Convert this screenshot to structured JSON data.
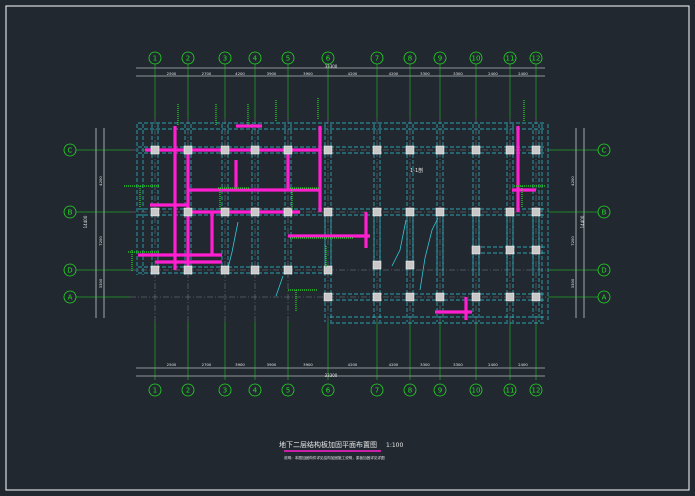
{
  "drawing": {
    "title": "地下二层结构板加固平面布置图",
    "scale": "1:100",
    "note": "说明：本图加固构件详见结构加固施工说明，梁板加固详见详图",
    "center_label": "1-1剖",
    "total_dim_top": "33300",
    "total_dim_bottom": "33300",
    "total_dim_left": "14400",
    "total_dim_right": "14400"
  },
  "axes": {
    "vertical_top": [
      "1",
      "2",
      "3",
      "4",
      "5",
      "6",
      "7",
      "8",
      "9",
      "10",
      "11",
      "12"
    ],
    "vertical_bottom": [
      "1",
      "2",
      "3",
      "4",
      "5",
      "6",
      "7",
      "8",
      "9",
      "10",
      "11",
      "12"
    ],
    "horizontal_left": [
      "C",
      "B",
      "D",
      "A"
    ],
    "horizontal_right": [
      "C",
      "B",
      "D",
      "A"
    ]
  },
  "dims": {
    "top": [
      "2500",
      "2700",
      "4200",
      "3900",
      "3900",
      "4200",
      "4200",
      "3300",
      "3300",
      "2400",
      "2400"
    ],
    "bottom": [
      "2500",
      "2700",
      "3900",
      "3900",
      "3900",
      "4200",
      "4200",
      "3300",
      "3300",
      "2400",
      "2400"
    ],
    "left": [
      "4200",
      "7200",
      "3300"
    ],
    "right": [
      "4200",
      "7200",
      "3300"
    ]
  },
  "colors": {
    "background": "#212830",
    "frame": "#ffffff",
    "axis": "#22dd22",
    "beam": "#30c8d8",
    "column": "#c8c8c8",
    "reinforce": "#ff1fd0",
    "text": "#e8e8e8"
  }
}
